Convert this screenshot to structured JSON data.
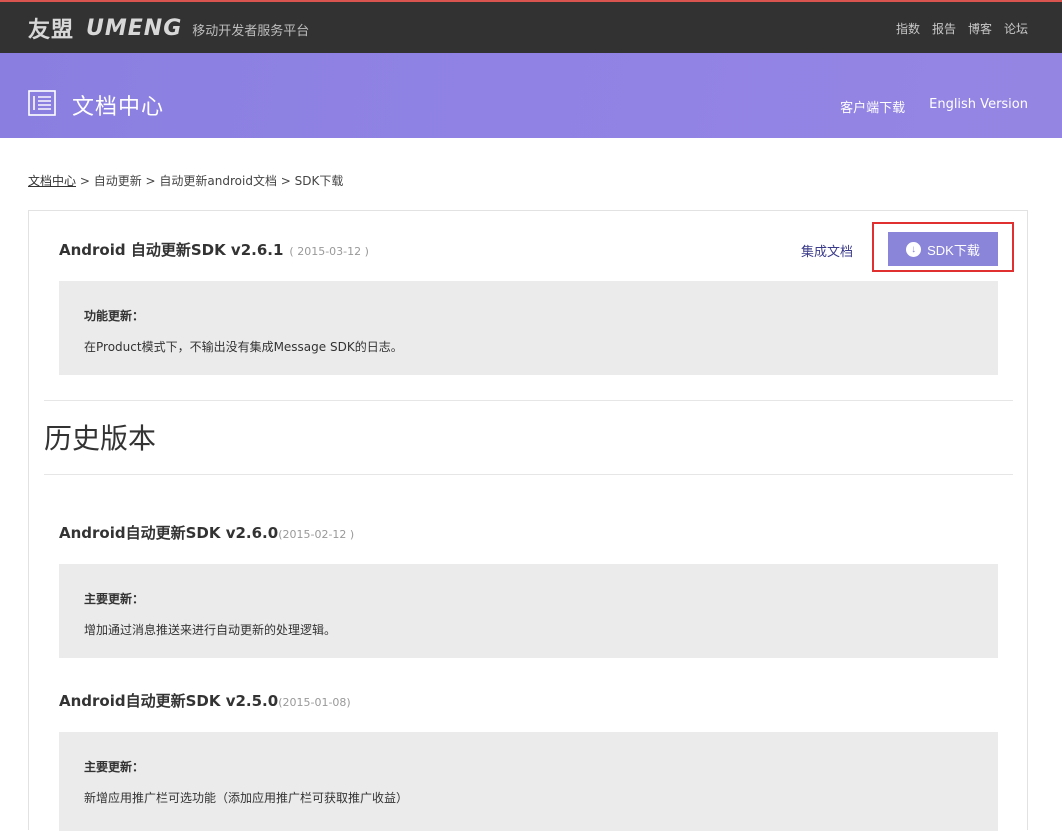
{
  "topbar": {
    "logo_cn": "友盟",
    "logo_en": "UMENG",
    "tagline": "移动开发者服务平台",
    "nav": [
      "指数",
      "报告",
      "博客",
      "论坛"
    ]
  },
  "banner": {
    "icon": "document-icon",
    "title": "文档中心",
    "links": [
      "客户端下载",
      "English Version"
    ]
  },
  "breadcrumb": {
    "home": "文档中心",
    "sep1": " > ",
    "item1": "自动更新",
    "sep2": " > ",
    "item2": "自动更新android文档",
    "sep3": " > ",
    "current": "SDK下载"
  },
  "current": {
    "title": "Android 自动更新SDK v2.6.1",
    "date": "( 2015-03-12 )",
    "doc_link": "集成文档",
    "download_button": "SDK下载",
    "download_icon": "download-arrow-icon",
    "note_heading": "功能更新：",
    "note_body": "在Product模式下，不输出没有集成Message SDK的日志。"
  },
  "history": {
    "title": "历史版本",
    "versions": [
      {
        "title": "Android自动更新SDK v2.6.0",
        "date": "(2015-02-12 )",
        "note_heading": "主要更新：",
        "note_body": "增加通过消息推送来进行自动更新的处理逻辑。"
      },
      {
        "title": "Android自动更新SDK v2.5.0",
        "date": "(2015-01-08)",
        "note_heading": "主要更新：",
        "note_body": "新增应用推广栏可选功能（添加应用推广栏可获取推广收益）"
      }
    ]
  },
  "colors": {
    "topbar_bg": "#323232",
    "banner_accent": "#8a7fe0",
    "button_bg": "#8a85d9",
    "highlight_border": "#e03030"
  }
}
